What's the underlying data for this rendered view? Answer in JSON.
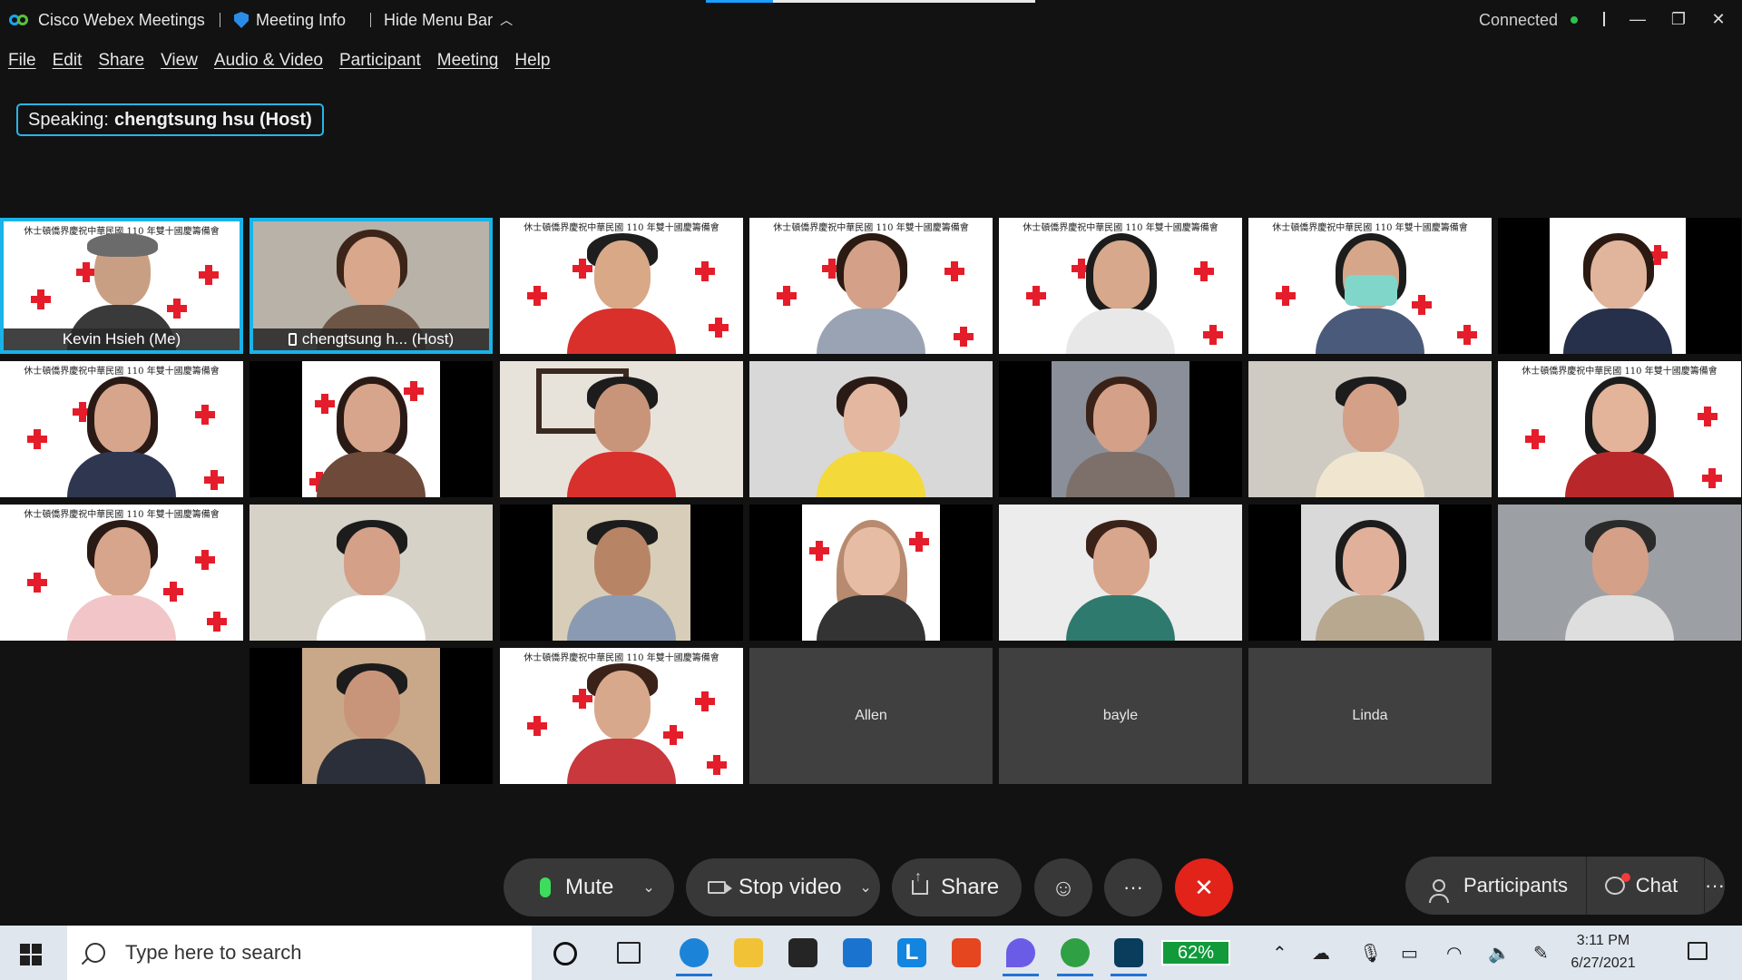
{
  "titlebar": {
    "app_name": "Cisco Webex Meetings",
    "meeting_info": "Meeting Info",
    "hide_menu": "Hide Menu Bar",
    "status": "Connected",
    "status_color": "#2ec24d"
  },
  "menu": [
    "File",
    "Edit",
    "Share",
    "View",
    "Audio & Video",
    "Participant",
    "Meeting",
    "Help"
  ],
  "speaking": {
    "label": "Speaking:",
    "name": "chengtsung hsu (Host)"
  },
  "banner_text": "休士頓僑界慶祝中華民國 110 年雙十國慶籌備會",
  "tiles": {
    "self_name": "Kevin Hsieh  (Me)",
    "host_name": "chengtsung h...  (Host)",
    "names": [
      "Allen",
      "bayle",
      "Linda"
    ]
  },
  "controls": {
    "mute": "Mute",
    "stop_video": "Stop video",
    "share": "Share",
    "participants": "Participants",
    "chat": "Chat",
    "more": "···",
    "leave_color": "#e2231a",
    "mic_color": "#3ddc5c"
  },
  "taskbar": {
    "search_placeholder": "Type here to search",
    "battery": "62%",
    "time": "3:11 PM",
    "date": "6/27/2021"
  }
}
